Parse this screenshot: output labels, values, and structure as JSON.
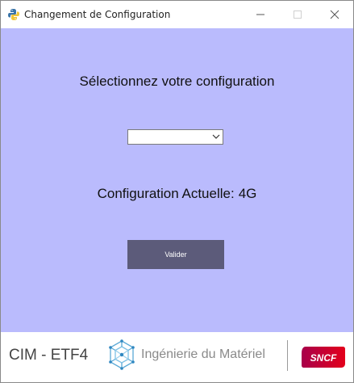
{
  "window": {
    "title": "Changement de Configuration",
    "app_icon": "python-icon",
    "controls": [
      "minimize-icon",
      "maximize-icon",
      "close-icon"
    ]
  },
  "main": {
    "heading": "Sélectionnez votre configuration",
    "config_select": {
      "value": "",
      "icon": "chevron-down-icon"
    },
    "current_config_label": "Configuration Actuelle:",
    "current_config_value": "4G",
    "validate_label": "Valider",
    "background_color": "#babbfd",
    "button_color": "#5c5b7a"
  },
  "footer": {
    "left_text": "CIM - ETF4",
    "logo_icon": "network-hexagon-icon",
    "middle_text": "Ingénierie du Matériel",
    "brand_logo": "sncf-logo",
    "brand_text": "SNCF",
    "brand_colors": [
      "#a8004a",
      "#e3001b"
    ]
  }
}
